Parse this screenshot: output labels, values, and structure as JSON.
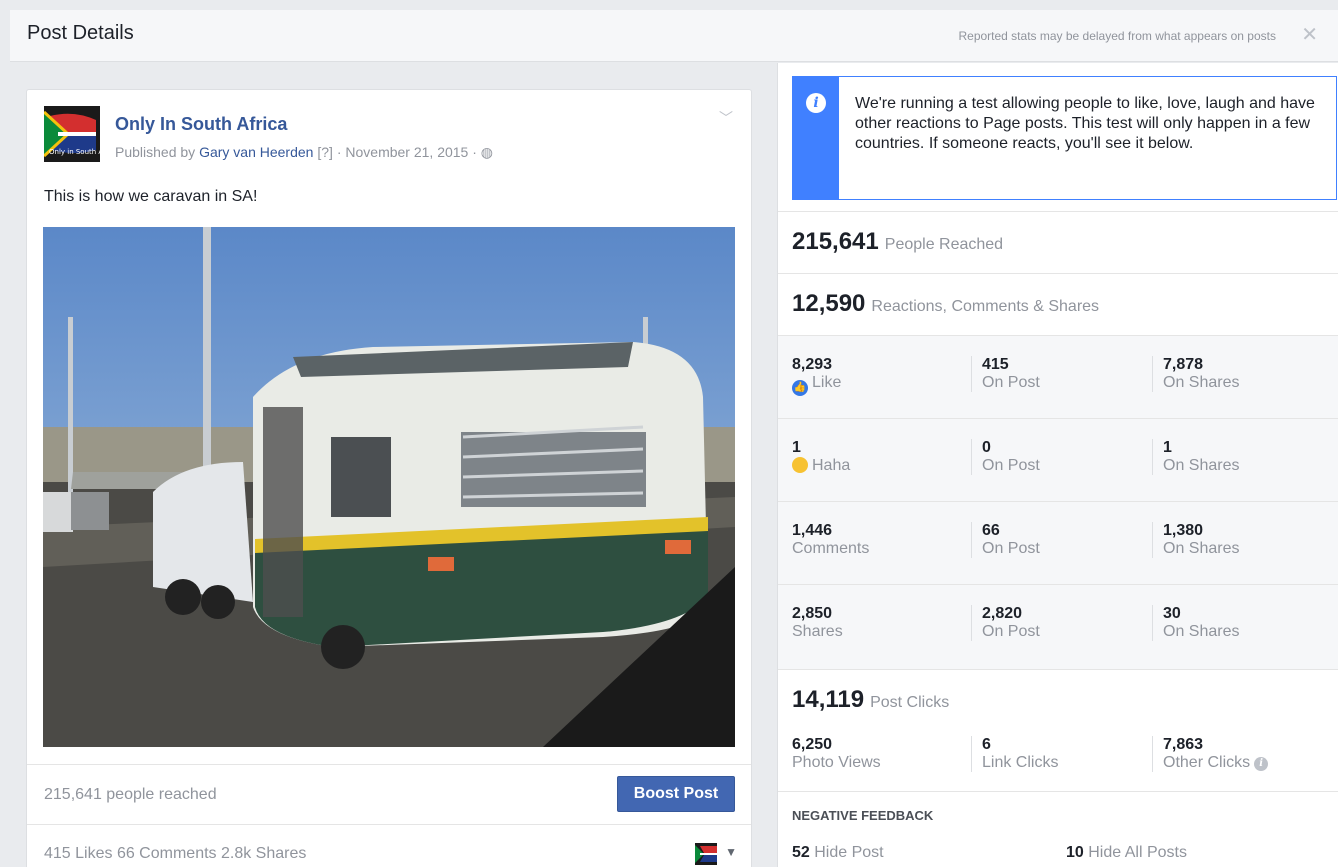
{
  "header": {
    "title": "Post Details",
    "note": "Reported stats may be delayed from what appears on posts",
    "close": "✕"
  },
  "post": {
    "avatar_text": "Only in South Africa",
    "page_name": "Only In South Africa",
    "published_by_prefix": "Published by",
    "author": "Gary van Heerden",
    "help": "[?]",
    "date": "· November 21, 2015 ·",
    "message": "This is how we caravan in SA!",
    "reached": "215,641 people reached",
    "boost_label": "Boost Post",
    "engagement": "415 Likes   66 Comments   2.8k Shares"
  },
  "info": {
    "text": "We're running a test allowing people to like, love, laugh and have other reactions to Page posts. This test will only happen in a few countries. If someone reacts, you'll see it below."
  },
  "stats": {
    "reached": {
      "value": "215,641",
      "label": "People Reached"
    },
    "reactions": {
      "value": "12,590",
      "label": "Reactions, Comments & Shares"
    },
    "rows": [
      {
        "total": "8,293",
        "total_label": "Like",
        "on_post": "415",
        "on_post_label": "On Post",
        "on_shares": "7,878",
        "on_shares_label": "On Shares"
      },
      {
        "total": "1",
        "total_label": "Haha",
        "on_post": "0",
        "on_post_label": "On Post",
        "on_shares": "1",
        "on_shares_label": "On Shares"
      },
      {
        "total": "1,446",
        "total_label": "Comments",
        "on_post": "66",
        "on_post_label": "On Post",
        "on_shares": "1,380",
        "on_shares_label": "On Shares"
      },
      {
        "total": "2,850",
        "total_label": "Shares",
        "on_post": "2,820",
        "on_post_label": "On Post",
        "on_shares": "30",
        "on_shares_label": "On Shares"
      }
    ],
    "clicks": {
      "value": "14,119",
      "label": "Post Clicks",
      "photo_views": "6,250",
      "photo_views_label": "Photo Views",
      "link_clicks": "6",
      "link_clicks_label": "Link Clicks",
      "other_clicks": "7,863",
      "other_clicks_label": "Other Clicks"
    },
    "negative": {
      "title": "NEGATIVE FEEDBACK",
      "hide_post": "52",
      "hide_post_label": "Hide Post",
      "hide_all": "10",
      "hide_all_label": "Hide All Posts"
    }
  }
}
